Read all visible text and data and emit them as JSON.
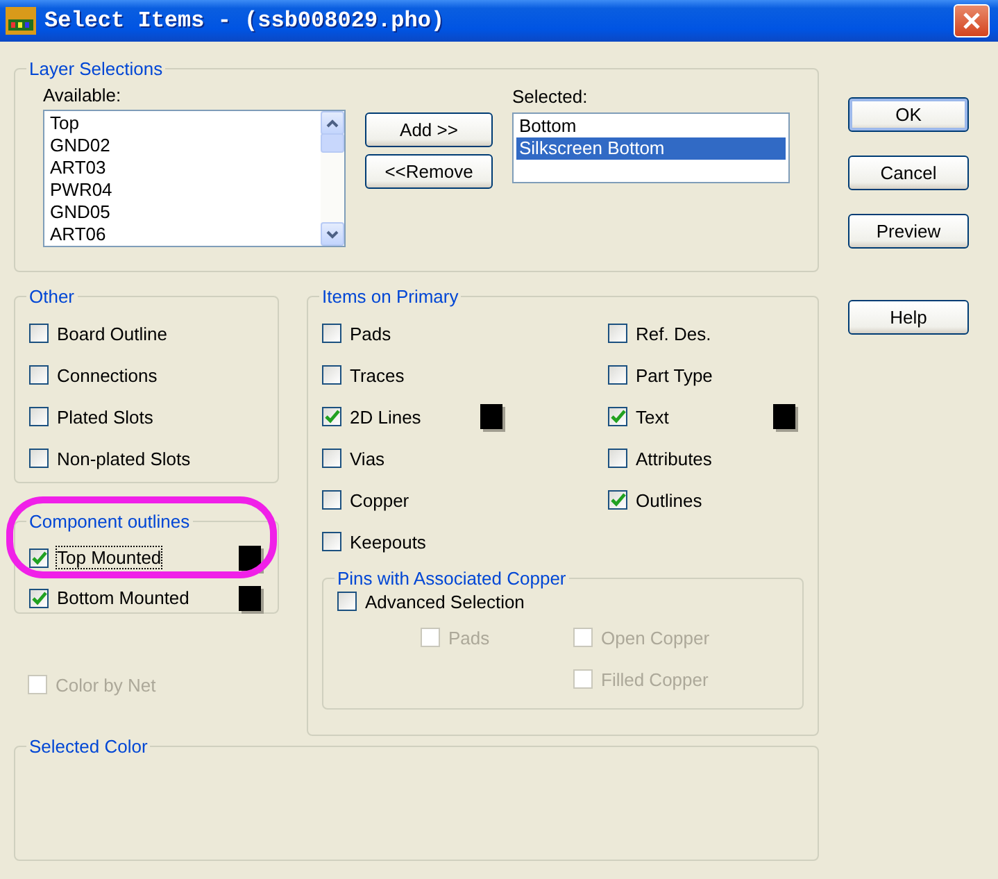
{
  "window": {
    "title": "Select Items - (ssb008029.pho)"
  },
  "layer_selections": {
    "title": "Layer Selections",
    "available": {
      "label": "Available:",
      "items": [
        "Top",
        "GND02",
        "ART03",
        "PWR04",
        "GND05",
        "ART06"
      ]
    },
    "buttons": [
      {
        "label": "Add >>"
      },
      {
        "label": "<<Remove"
      }
    ],
    "selected": {
      "label": "Selected:",
      "items": [
        {
          "text": "Bottom",
          "selected": false
        },
        {
          "text": "Silkscreen Bottom",
          "selected": true
        }
      ]
    }
  },
  "dialog_buttons": [
    {
      "label": "OK",
      "default": true
    },
    {
      "label": "Cancel",
      "default": false
    },
    {
      "label": "Preview",
      "default": false
    },
    {
      "label": "Help",
      "default": false
    }
  ],
  "other": {
    "title": "Other",
    "items": [
      {
        "label": "Board Outline",
        "checked": false
      },
      {
        "label": "Connections",
        "checked": false
      },
      {
        "label": "Plated Slots",
        "checked": false
      },
      {
        "label": "Non-plated Slots",
        "checked": false
      }
    ]
  },
  "component_outlines": {
    "title": "Component outlines",
    "items": [
      {
        "label": "Top Mounted",
        "checked": true,
        "focused": true,
        "color": "#000000"
      },
      {
        "label": "Bottom Mounted",
        "checked": true,
        "focused": false,
        "color": "#000000"
      }
    ]
  },
  "color_by_net": {
    "label": "Color by Net",
    "checked": false,
    "disabled": true
  },
  "items_on_primary": {
    "title": "Items on Primary",
    "columns": [
      [
        {
          "label": "Pads",
          "checked": false
        },
        {
          "label": "Traces",
          "checked": false
        },
        {
          "label": "2D Lines",
          "checked": true,
          "color": "#000000"
        },
        {
          "label": "Vias",
          "checked": false
        },
        {
          "label": "Copper",
          "checked": false
        },
        {
          "label": "Keepouts",
          "checked": false
        }
      ],
      [
        {
          "label": "Ref. Des.",
          "checked": false
        },
        {
          "label": "Part Type",
          "checked": false
        },
        {
          "label": "Text",
          "checked": true,
          "color": "#000000"
        },
        {
          "label": "Attributes",
          "checked": false
        },
        {
          "label": "Outlines",
          "checked": true
        }
      ]
    ]
  },
  "pins_with_associated_copper": {
    "title": "Pins with Associated Copper",
    "advanced": {
      "label": "Advanced Selection",
      "checked": false
    },
    "options": [
      {
        "label": "Pads",
        "checked": false,
        "disabled": true
      },
      {
        "label": "Open Copper",
        "checked": false,
        "disabled": true
      },
      {
        "label": "Filled Copper",
        "checked": false,
        "disabled": true
      }
    ]
  },
  "selected_color": {
    "title": "Selected Color"
  }
}
